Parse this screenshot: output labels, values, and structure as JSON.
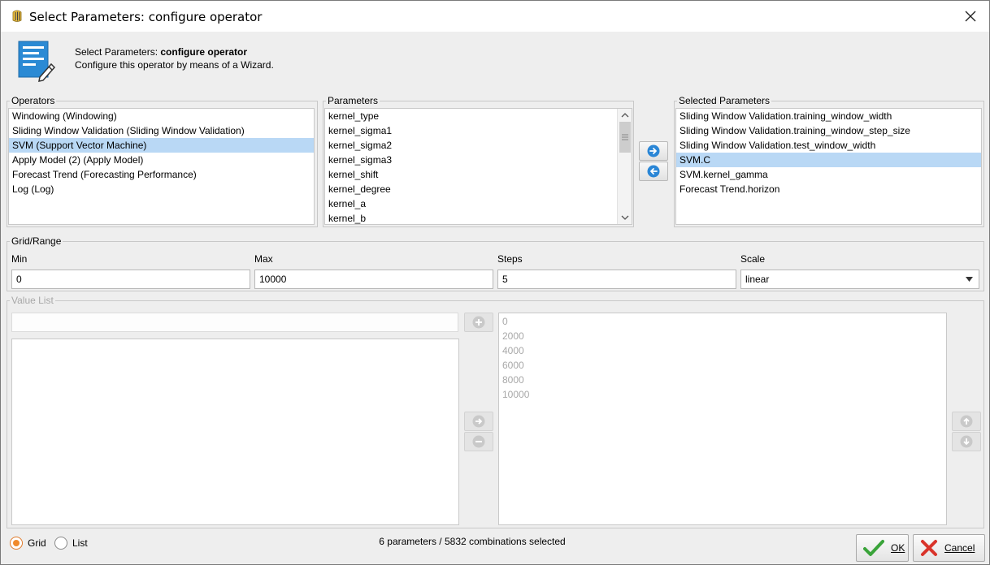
{
  "window": {
    "title": "Select Parameters: configure operator"
  },
  "header": {
    "title_prefix": "Select Parameters: ",
    "title_bold": "configure operator",
    "subtitle": "Configure this operator by means of a Wizard."
  },
  "operators": {
    "label": "Operators",
    "items": [
      "Windowing (Windowing)",
      "Sliding Window Validation (Sliding Window Validation)",
      "SVM (Support Vector Machine)",
      "Apply Model (2) (Apply Model)",
      "Forecast Trend (Forecasting Performance)",
      "Log (Log)"
    ],
    "selected_index": 2
  },
  "parameters": {
    "label": "Parameters",
    "items": [
      "kernel_type",
      "kernel_sigma1",
      "kernel_sigma2",
      "kernel_sigma3",
      "kernel_shift",
      "kernel_degree",
      "kernel_a",
      "kernel_b"
    ]
  },
  "selected_parameters": {
    "label": "Selected Parameters",
    "items": [
      "Sliding Window Validation.training_window_width",
      "Sliding Window Validation.training_window_step_size",
      "Sliding Window Validation.test_window_width",
      "SVM.C",
      "SVM.kernel_gamma",
      "Forecast Trend.horizon"
    ],
    "selected_index": 3
  },
  "grid_range": {
    "label": "Grid/Range",
    "min_label": "Min",
    "min_value": "0",
    "max_label": "Max",
    "max_value": "10000",
    "steps_label": "Steps",
    "steps_value": "5",
    "scale_label": "Scale",
    "scale_value": "linear"
  },
  "value_list": {
    "label": "Value List",
    "input_value": "",
    "values": [
      "0",
      "2000",
      "4000",
      "6000",
      "8000",
      "10000"
    ]
  },
  "mode": {
    "grid_label": "Grid",
    "list_label": "List",
    "selected": "Grid"
  },
  "status": "6 parameters / 5832 combinations selected",
  "buttons": {
    "ok_label": "OK",
    "cancel_label": "Cancel"
  },
  "colors": {
    "selection": "#b9d8f5",
    "ok_check": "#3aa43a",
    "cancel_x": "#d9342b",
    "radio_accent": "#f08a2c",
    "arrow_blue": "#2a86d6"
  }
}
